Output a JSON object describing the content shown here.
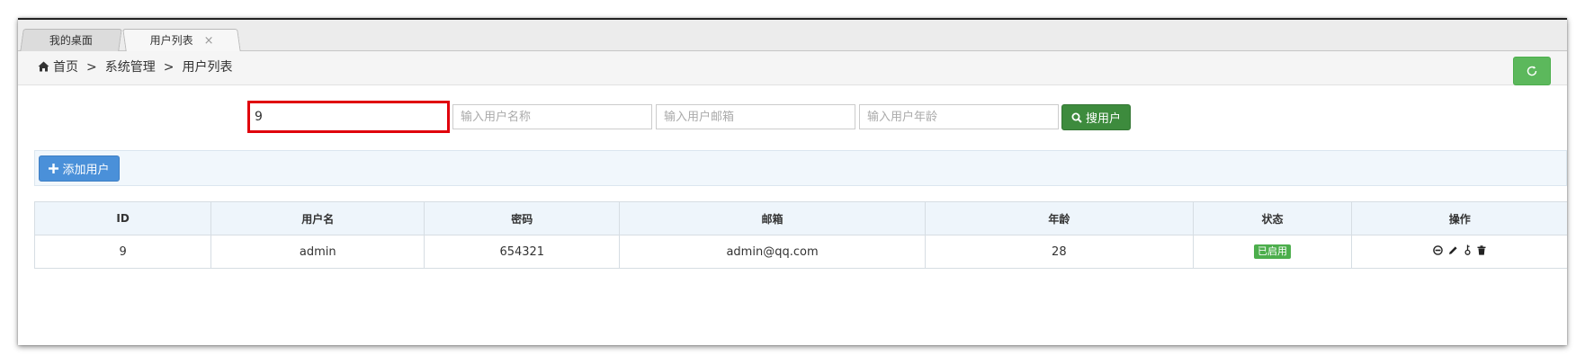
{
  "tabs": [
    {
      "label": "我的桌面"
    },
    {
      "label": "用户列表",
      "close": "×"
    }
  ],
  "breadcrumb": {
    "items": [
      "首页",
      "系统管理",
      "用户列表"
    ],
    "separator": ">"
  },
  "search": {
    "id_value": "9",
    "name_placeholder": "输入用户名称",
    "email_placeholder": "输入用户邮箱",
    "age_placeholder": "输入用户年龄",
    "button_label": "搜用户"
  },
  "toolbar": {
    "add_label": "添加用户"
  },
  "table": {
    "headers": [
      "ID",
      "用户名",
      "密码",
      "邮箱",
      "年龄",
      "状态",
      "操作"
    ],
    "rows": [
      {
        "id": "9",
        "username": "admin",
        "password": "654321",
        "email": "admin@qq.com",
        "age": "28",
        "status": "已启用"
      }
    ]
  },
  "colors": {
    "refresh": "#5cb85c",
    "search_button": "#3d8b3d",
    "add_button": "#4a90d9",
    "focus_outline": "#e0000c",
    "status_badge": "#4cae4c"
  },
  "icons": {
    "home": "home-icon",
    "refresh": "refresh-icon",
    "search": "search-icon",
    "add": "plus-icon",
    "disable": "minus-circle-icon",
    "edit": "pencil-icon",
    "password": "key-icon",
    "delete": "trash-icon"
  }
}
